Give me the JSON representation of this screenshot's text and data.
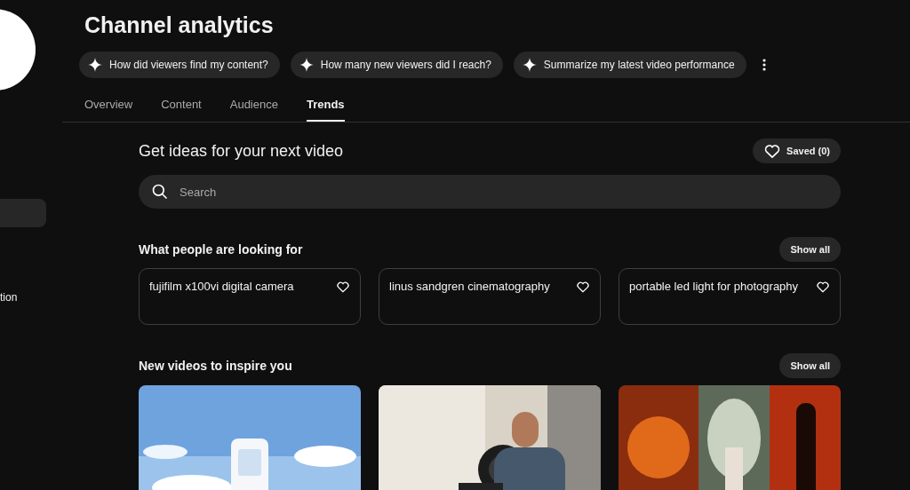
{
  "sidebar": {
    "items": [
      {
        "selected": true
      },
      {
        "label": "tion",
        "selected": false
      }
    ]
  },
  "header": {
    "title": "Channel analytics",
    "suggestions": [
      "How did viewers find my content?",
      "How many new viewers did I reach?",
      "Summarize my latest video performance"
    ]
  },
  "tabs": [
    {
      "label": "Overview",
      "selected": false
    },
    {
      "label": "Content",
      "selected": false
    },
    {
      "label": "Audience",
      "selected": false
    },
    {
      "label": "Trends",
      "selected": true
    }
  ],
  "ideas": {
    "title": "Get ideas for your next video",
    "saved": "Saved (0)",
    "search": {
      "placeholder": "Search"
    }
  },
  "searches": {
    "title": "What people are looking for",
    "show_all": "Show all",
    "items": [
      {
        "text": "fujifilm x100vi digital camera",
        "saved": false
      },
      {
        "text": "linus sandgren cinematography",
        "saved": false
      },
      {
        "text": "portable led light for photography",
        "saved": false
      }
    ]
  },
  "videos": {
    "title": "New videos to inspire you",
    "show_all": "Show all"
  }
}
